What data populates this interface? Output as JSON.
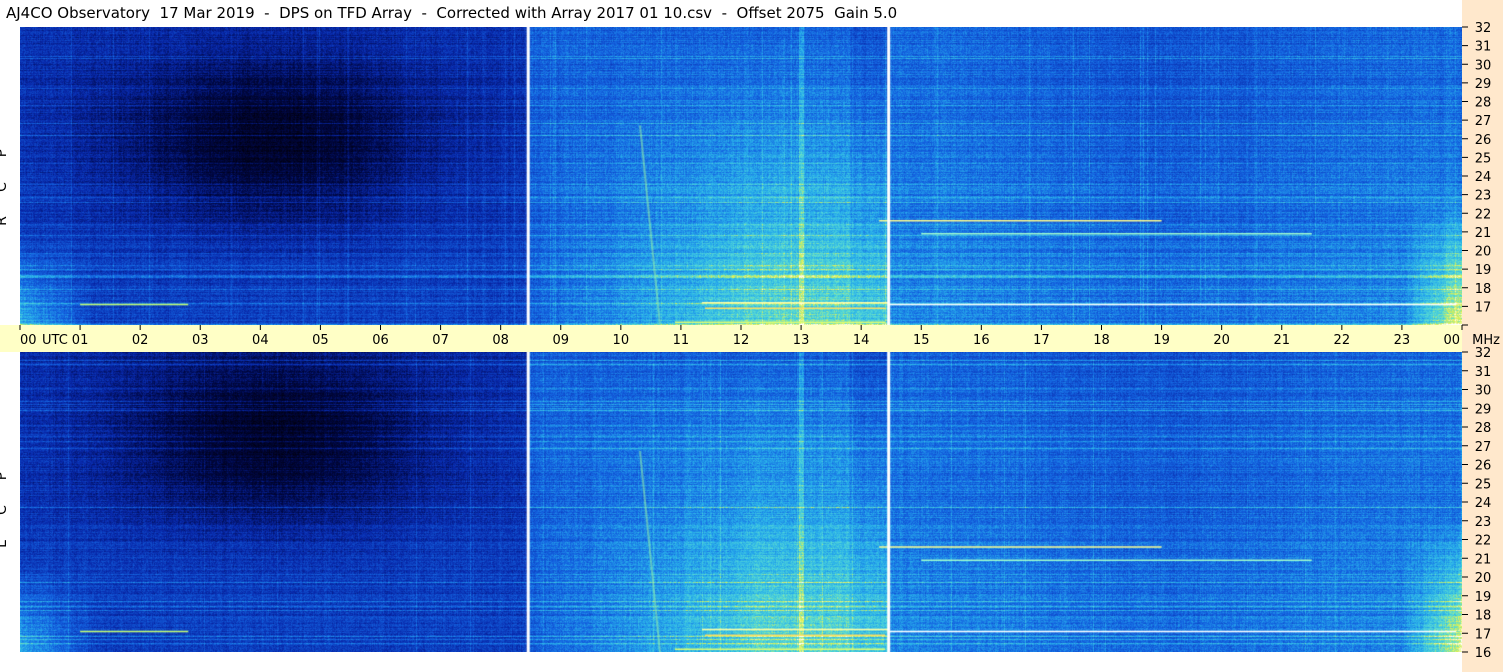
{
  "title": "AJ4CO Observatory  17 Mar 2019  -  DPS on TFD Array  -  Corrected with Array 2017 01 10.csv  -  Offset 2075  Gain 5.0",
  "colors": {
    "background_dark": "#000a2a",
    "band_light": "#ffffc6",
    "axis_strip": "#ffe8cc",
    "bright_spectrum": "#3ec8e8"
  },
  "polarizations": [
    {
      "label": "R C P",
      "letters": [
        "R",
        "C",
        "P"
      ]
    },
    {
      "label": "L C P",
      "letters": [
        "L",
        "C",
        "P"
      ]
    }
  ],
  "chart_data": {
    "type": "heatmap",
    "title": "AJ4CO Observatory  17 Mar 2019  -  DPS on TFD Array  -  Corrected with Array 2017 01 10.csv  -  Offset 2075  Gain 5.0",
    "x_unit_label": "UTC",
    "y_unit_label": "MHz",
    "x_ticks": [
      "00",
      "01",
      "02",
      "03",
      "04",
      "05",
      "06",
      "07",
      "08",
      "09",
      "10",
      "11",
      "12",
      "13",
      "14",
      "15",
      "16",
      "17",
      "18",
      "19",
      "20",
      "21",
      "22",
      "23",
      "00"
    ],
    "x_range_hours": [
      0,
      24
    ],
    "y_ticks": [
      16,
      17,
      18,
      19,
      20,
      21,
      22,
      23,
      24,
      25,
      26,
      27,
      28,
      29,
      30,
      31,
      32
    ],
    "y_range_mhz": [
      16,
      32
    ],
    "panels": [
      "R C P",
      "L C P"
    ],
    "gaps_utc_hours": [
      8.45,
      14.45
    ],
    "colormap": "dark navy (low) to blue, cyan, yellow, white (high)"
  }
}
